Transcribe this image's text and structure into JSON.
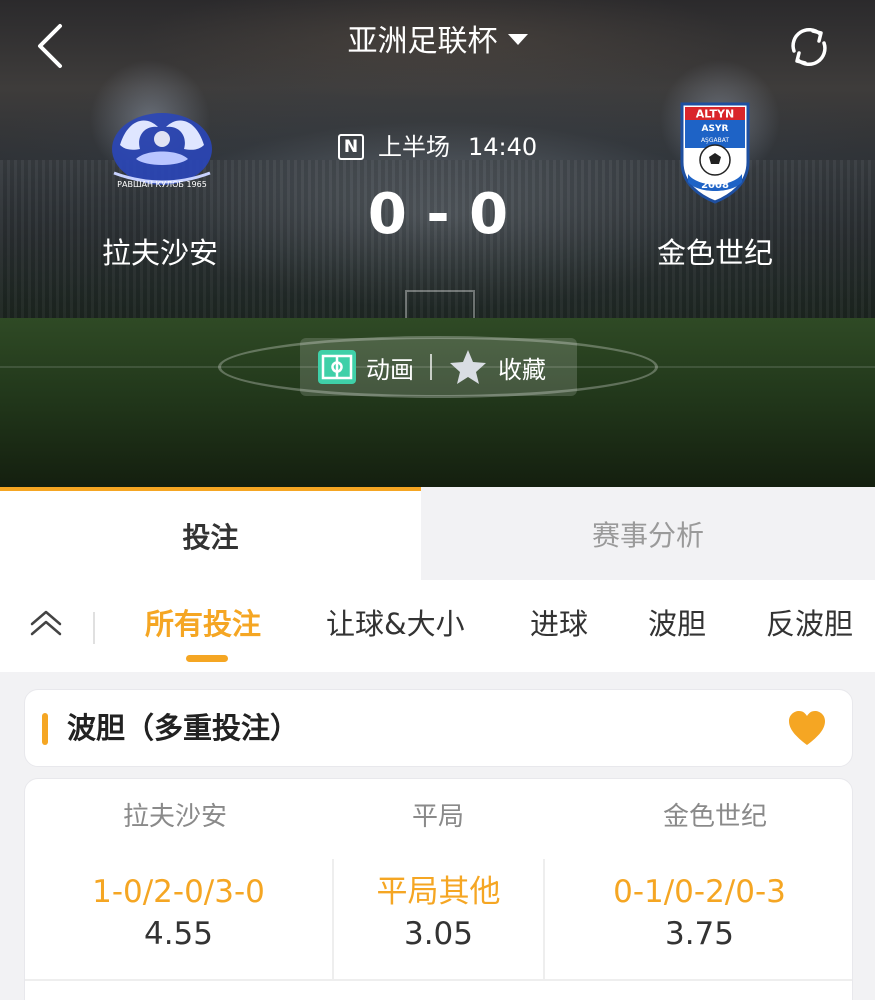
{
  "header": {
    "league": "亚洲足联杯",
    "status_icon": "N",
    "period": "上半场",
    "clock": "14:40",
    "score": "0 - 0",
    "home_team": "拉夫沙安",
    "away_team": "金色世纪",
    "animation_label": "动画",
    "favorite_label": "收藏",
    "home_logo_text": "РАВШАН КУЛОБ 1965",
    "away_logo_text_top": "ALTYN",
    "away_logo_text_mid": "ASYR",
    "away_logo_text_city": "AŞGABAT",
    "away_logo_year": "2008"
  },
  "main_tabs": [
    {
      "label": "投注",
      "active": true
    },
    {
      "label": "赛事分析",
      "active": false
    }
  ],
  "sub_tabs": [
    {
      "label": "所有投注",
      "active": true
    },
    {
      "label": "让球&大小",
      "active": false
    },
    {
      "label": "进球",
      "active": false
    },
    {
      "label": "波胆",
      "active": false
    },
    {
      "label": "反波胆",
      "active": false
    }
  ],
  "market": {
    "title": "波胆（多重投注）",
    "columns": [
      "拉夫沙安",
      "平局",
      "金色世纪"
    ],
    "rows": [
      [
        {
          "label": "1-0/2-0/3-0",
          "odds": "4.55"
        },
        {
          "label": "平局其他",
          "odds": "3.05"
        },
        {
          "label": "0-1/0-2/0-3",
          "odds": "3.75"
        }
      ]
    ]
  },
  "colors": {
    "accent": "#f5a623",
    "animation_icon": "#3fd0a8",
    "text_dark": "#333333",
    "text_muted": "#8a8a8a"
  },
  "icons": [
    "chevron-left-icon",
    "refresh-icon",
    "caret-down-icon",
    "n-icon",
    "pitch-icon",
    "star-icon",
    "chevron-up-double-icon",
    "heart-icon"
  ]
}
